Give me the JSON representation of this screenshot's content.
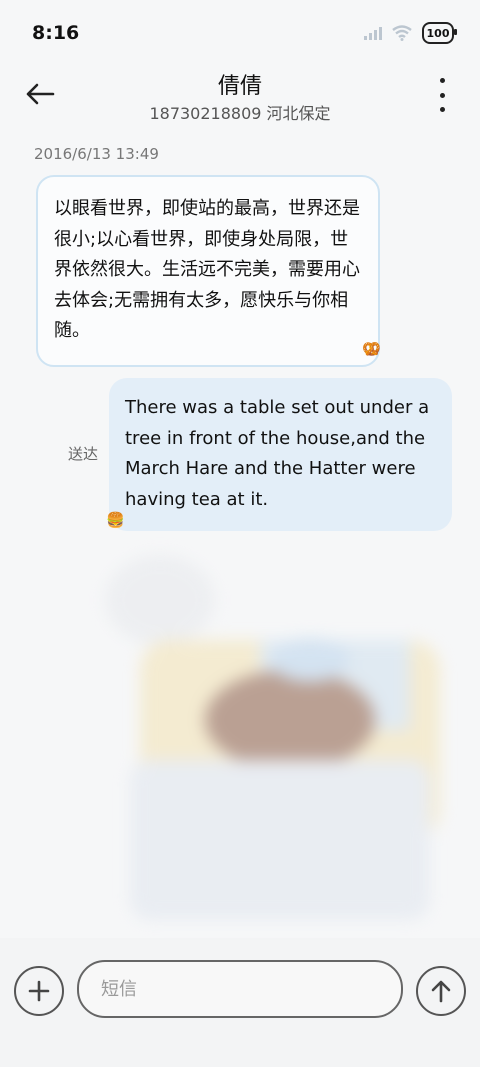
{
  "status_bar": {
    "time": "8:16",
    "battery": "100",
    "icons": [
      "signal-icon",
      "wifi-icon",
      "battery-icon"
    ]
  },
  "header": {
    "back_icon": "arrow-left-icon",
    "contact_name": "倩倩",
    "contact_info": "18730218809 河北保定",
    "more_icon": "more-vertical-icon"
  },
  "conversation": {
    "timestamp": "2016/6/13 13:49",
    "incoming": {
      "text": "以眼看世界，即使站的最高，世界还是很小;以心看世界，即使身处局限，世界依然很大。生活远不完美，需要用心去体会;无需拥有太多，愿快乐与你相随。",
      "sticker": "🥨"
    },
    "outgoing": {
      "text": "There was a table set out under a tree in front of the house,and the March Hare and the Hatter were having tea at it.",
      "status": "送达",
      "sticker": "🍔"
    }
  },
  "composer": {
    "add_icon": "plus-icon",
    "placeholder": "短信",
    "send_icon": "arrow-up-icon"
  },
  "colors": {
    "incoming_border": "#cfe4f3",
    "outgoing_bg": "#e3eef8",
    "background": "#f6f7f8"
  }
}
